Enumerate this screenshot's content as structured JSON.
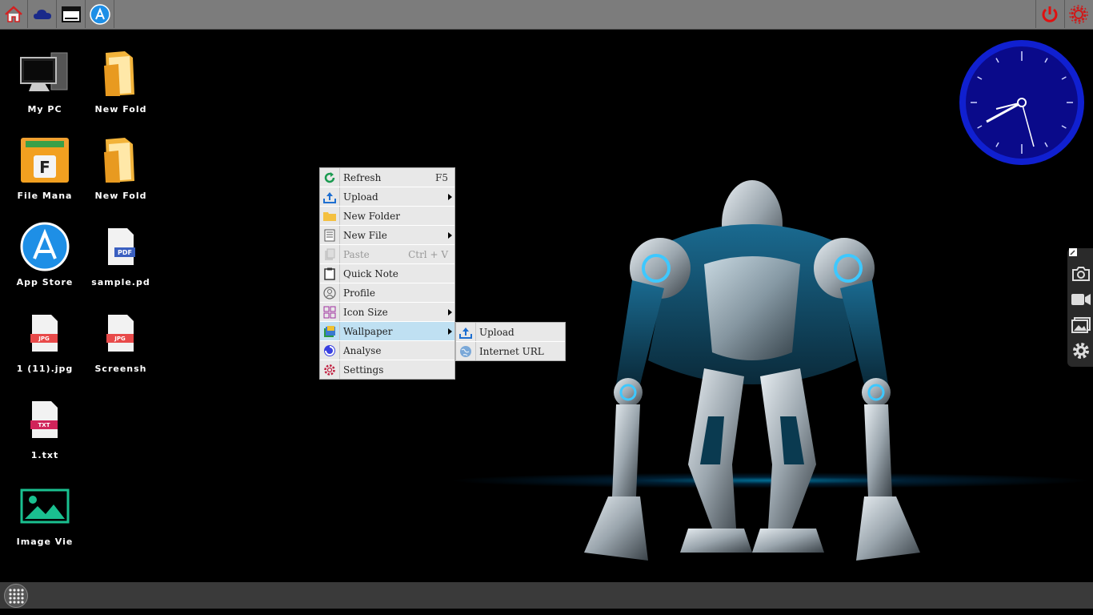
{
  "topbar": {
    "left_buttons": [
      {
        "name": "home-icon"
      },
      {
        "name": "cloud-icon"
      },
      {
        "name": "window-icon"
      },
      {
        "name": "app-store-icon"
      }
    ],
    "right_buttons": [
      {
        "name": "power-icon"
      },
      {
        "name": "gear-icon"
      }
    ]
  },
  "desktop": {
    "icons": [
      {
        "label": "My PC"
      },
      {
        "label": "New Fold"
      },
      {
        "label": "File Mana"
      },
      {
        "label": "New Fold"
      },
      {
        "label": "App Store"
      },
      {
        "label": "sample.pd"
      },
      {
        "label": "1 (11).jpg"
      },
      {
        "label": "Screensh"
      },
      {
        "label": "1.txt"
      },
      {
        "label": "Image Vie"
      }
    ],
    "badges": {
      "pdf": "PDF",
      "jpg": "JPG",
      "txt": "TXT",
      "file_letter": "F"
    }
  },
  "context_menu": {
    "items": [
      {
        "label": "Refresh",
        "shortcut": "F5"
      },
      {
        "label": "Upload",
        "shortcut": ""
      },
      {
        "label": "New Folder",
        "shortcut": ""
      },
      {
        "label": "New File",
        "shortcut": ""
      },
      {
        "label": "Paste",
        "shortcut": "Ctrl + V"
      },
      {
        "label": "Quick Note",
        "shortcut": ""
      },
      {
        "label": "Profile",
        "shortcut": ""
      },
      {
        "label": "Icon Size",
        "shortcut": ""
      },
      {
        "label": "Wallpaper",
        "shortcut": ""
      },
      {
        "label": "Analyse",
        "shortcut": ""
      },
      {
        "label": "Settings",
        "shortcut": ""
      }
    ]
  },
  "wallpaper_submenu": {
    "items": [
      {
        "label": "Upload"
      },
      {
        "label": "Internet URL"
      }
    ]
  },
  "colors": {
    "topbar": "#7c7c7c",
    "taskbar": "#3a3a3a",
    "menu_bg": "#e8e8e8",
    "menu_active": "#bfe0f2",
    "clock_face": "#0a0a8a",
    "clock_ring": "#1020d0",
    "accent_red": "#d01818"
  }
}
